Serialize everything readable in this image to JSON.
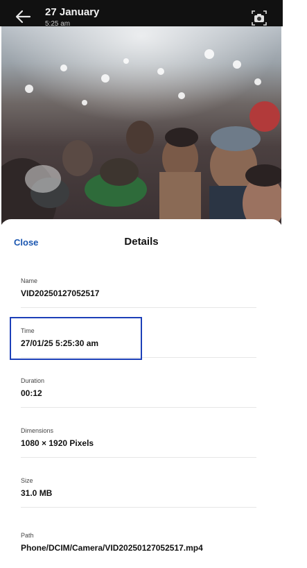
{
  "header": {
    "date": "27 January",
    "time": "5:25 am"
  },
  "icons": {
    "back": "arrow-left-icon",
    "camera": "camera-icon"
  },
  "details": {
    "close_label": "Close",
    "title": "Details",
    "fields": [
      {
        "label": "Name",
        "value": "VID20250127052517"
      },
      {
        "label": "Time",
        "value": "27/01/25 5:25:30 am"
      },
      {
        "label": "Duration",
        "value": "00:12"
      },
      {
        "label": "Dimensions",
        "value": "1080 × 1920 Pixels"
      },
      {
        "label": "Size",
        "value": "31.0 MB"
      },
      {
        "label": "Path",
        "value": "Phone/DCIM/Camera/VID20250127052517.mp4"
      }
    ]
  },
  "colors": {
    "link": "#1a56b0",
    "highlight_border": "#1c3fb8"
  }
}
